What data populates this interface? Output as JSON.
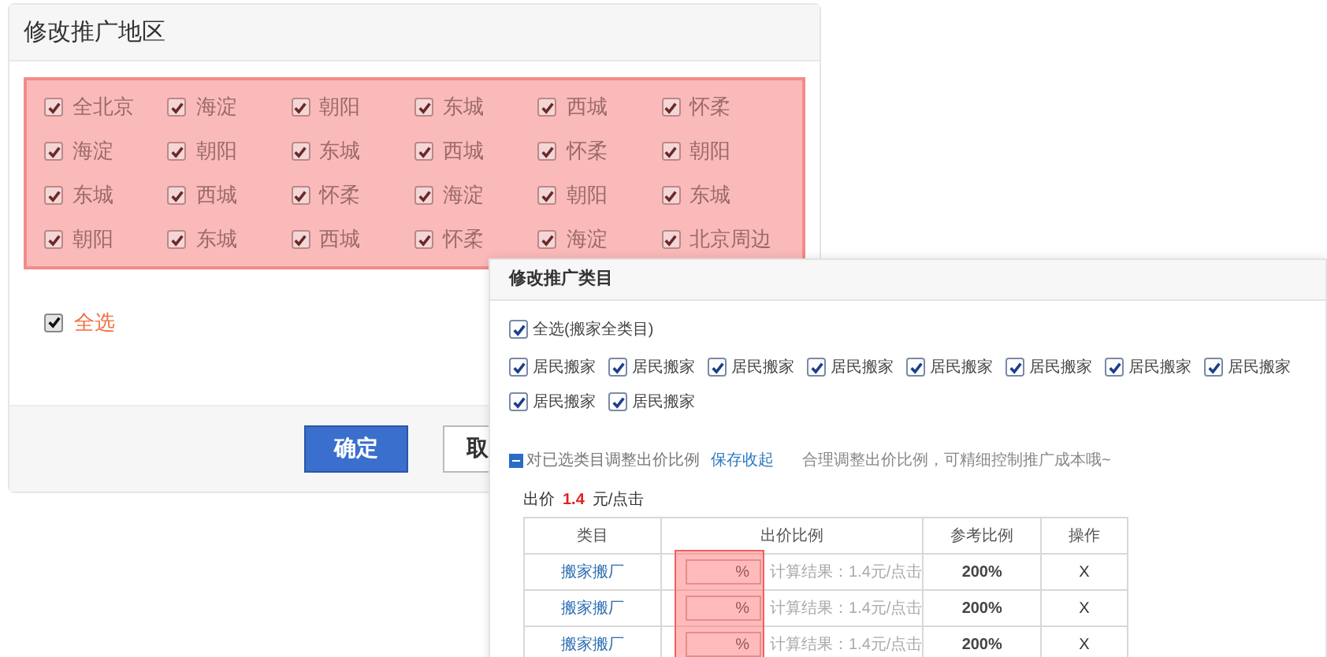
{
  "left_dialog": {
    "title": "修改推广地区",
    "regions": [
      {
        "label": "全北京",
        "checked": true
      },
      {
        "label": "海淀",
        "checked": true
      },
      {
        "label": "朝阳",
        "checked": true
      },
      {
        "label": "东城",
        "checked": true
      },
      {
        "label": "西城",
        "checked": true
      },
      {
        "label": "怀柔",
        "checked": true
      },
      {
        "label": "海淀",
        "checked": true
      },
      {
        "label": "朝阳",
        "checked": true
      },
      {
        "label": "东城",
        "checked": true
      },
      {
        "label": "西城",
        "checked": true
      },
      {
        "label": "怀柔",
        "checked": true
      },
      {
        "label": "朝阳",
        "checked": true
      },
      {
        "label": "东城",
        "checked": true
      },
      {
        "label": "西城",
        "checked": true
      },
      {
        "label": "怀柔",
        "checked": true
      },
      {
        "label": "海淀",
        "checked": true
      },
      {
        "label": "朝阳",
        "checked": true
      },
      {
        "label": "东城",
        "checked": true
      },
      {
        "label": "朝阳",
        "checked": true
      },
      {
        "label": "东城",
        "checked": true
      },
      {
        "label": "西城",
        "checked": true
      },
      {
        "label": "怀柔",
        "checked": true
      },
      {
        "label": "海淀",
        "checked": true
      },
      {
        "label": "北京周边",
        "checked": true
      }
    ],
    "select_all": {
      "label": "全选",
      "checked": true
    },
    "buttons": [
      {
        "label": "确定",
        "kind": "primary"
      },
      {
        "label": "取",
        "kind": "secondary"
      }
    ]
  },
  "right_dialog": {
    "title": "修改推广类目",
    "select_all": {
      "label": "全选(搬家全类目)",
      "checked": true
    },
    "categories": [
      {
        "label": "居民搬家",
        "checked": true
      },
      {
        "label": "居民搬家",
        "checked": true
      },
      {
        "label": "居民搬家",
        "checked": true
      },
      {
        "label": "居民搬家",
        "checked": true
      },
      {
        "label": "居民搬家",
        "checked": true
      },
      {
        "label": "居民搬家",
        "checked": true
      },
      {
        "label": "居民搬家",
        "checked": true
      },
      {
        "label": "居民搬家",
        "checked": true
      },
      {
        "label": "居民搬家",
        "checked": true
      },
      {
        "label": "居民搬家",
        "checked": true
      }
    ],
    "adjust": {
      "label": "对已选类目调整出价比例",
      "expanded": true,
      "link": "保存收起",
      "hint": "合理调整出价比例，可精细控制推广成本哦~"
    },
    "bid": {
      "label": "出价",
      "value": "1.4",
      "unit": "元/点击"
    },
    "table": {
      "columns": [
        "类目",
        "出价比例",
        "参考比例",
        "操作"
      ],
      "rows": [
        {
          "category": "搬家搬厂",
          "unit": "%",
          "result": "计算结果：1.4元/点击",
          "reference": "200%",
          "action": "X"
        },
        {
          "category": "搬家搬厂",
          "unit": "%",
          "result": "计算结果：1.4元/点击",
          "reference": "200%",
          "action": "X"
        },
        {
          "category": "搬家搬厂",
          "unit": "%",
          "result": "计算结果：1.4元/点击",
          "reference": "200%",
          "action": "X"
        }
      ]
    }
  }
}
